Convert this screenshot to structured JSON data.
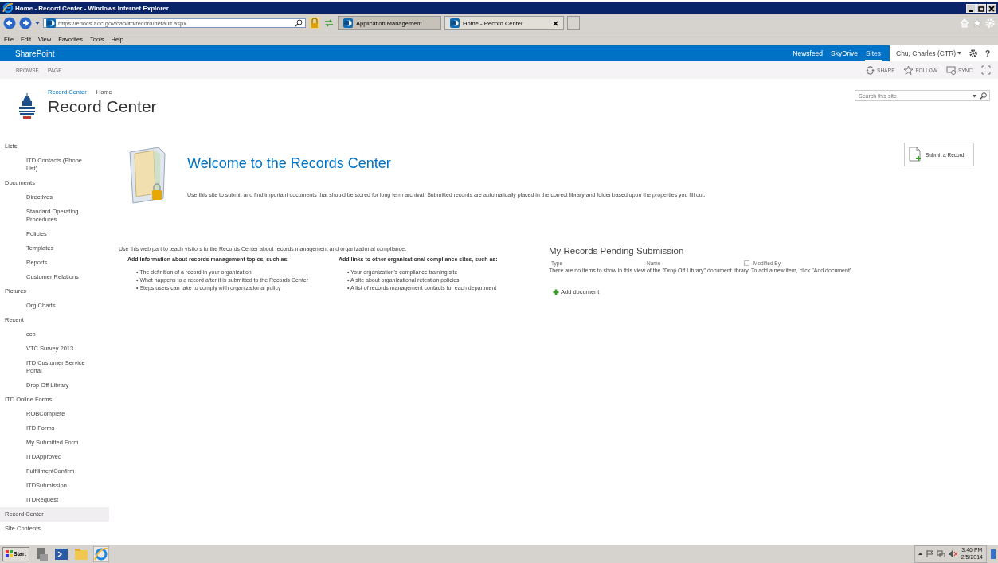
{
  "window": {
    "title": "Home - Record Center - Windows Internet Explorer"
  },
  "browser": {
    "url": "https://edocs.aoc.gov/cao/itd/record/default.aspx",
    "tabs": [
      {
        "label": "Application Management",
        "selected": false
      },
      {
        "label": "Home - Record Center",
        "selected": true
      }
    ]
  },
  "menu_bar": [
    "File",
    "Edit",
    "View",
    "Favorites",
    "Tools",
    "Help"
  ],
  "suite_bar": {
    "brand": "SharePoint",
    "links": [
      {
        "label": "Newsfeed",
        "selected": false
      },
      {
        "label": "SkyDrive",
        "selected": false
      },
      {
        "label": "Sites",
        "selected": true
      }
    ],
    "user": "Chu, Charles (CTR)",
    "help": "?"
  },
  "ribbon": {
    "tabs": [
      "BROWSE",
      "PAGE"
    ],
    "actions": [
      "SHARE",
      "FOLLOW",
      "SYNC"
    ]
  },
  "header": {
    "breadcrumb": [
      "Record Center",
      "Home"
    ],
    "site_title": "Record Center",
    "search": {
      "placeholder": "Search this site"
    }
  },
  "quick_launch": [
    {
      "label": "Lists",
      "selected": false,
      "children": [
        {
          "label": "ITD Contacts (Phone List)",
          "selected": false
        }
      ]
    },
    {
      "label": "Documents",
      "selected": false,
      "children": [
        {
          "label": "Directives",
          "selected": false
        },
        {
          "label": "Standard Operating Procedures",
          "selected": false
        },
        {
          "label": "Policies",
          "selected": false
        },
        {
          "label": "Templates",
          "selected": false
        },
        {
          "label": "Reports",
          "selected": false
        },
        {
          "label": "Customer Relations",
          "selected": false
        }
      ]
    },
    {
      "label": "Pictures",
      "selected": false,
      "children": [
        {
          "label": "Org Charts",
          "selected": false
        }
      ]
    },
    {
      "label": "Recent",
      "selected": false,
      "children": [
        {
          "label": "ccb",
          "selected": false
        },
        {
          "label": "VTC Survey 2013",
          "selected": false
        },
        {
          "label": "ITD Customer Service Portal",
          "selected": false
        },
        {
          "label": "Drop Off Library",
          "selected": false
        }
      ]
    },
    {
      "label": "ITD Online Forms",
      "selected": false,
      "children": [
        {
          "label": "ROBComplete",
          "selected": false
        },
        {
          "label": "ITD Forms",
          "selected": false
        },
        {
          "label": "My Submitted Form",
          "selected": false
        },
        {
          "label": "ITDApproved",
          "selected": false
        },
        {
          "label": "FulfillmentConfirm",
          "selected": false
        },
        {
          "label": "ITDSubmission",
          "selected": false
        },
        {
          "label": "ITDRequest",
          "selected": false
        }
      ]
    },
    {
      "label": "Record Center",
      "selected": true
    },
    {
      "label": "Site Contents",
      "selected": false
    }
  ],
  "welcome": {
    "title": "Welcome to the Records Center",
    "text": "Use this site to submit and find important documents that should be stored for long term archival. Submitted records are automatically placed in the correct library and folder based upon the properties you fill out.",
    "submit_button": "Submit a Record"
  },
  "info": {
    "intro": "Use this web part to teach visitors to the Records Center about records management and organizational compliance.",
    "columns": [
      {
        "heading": "Add information about records management topics, such as:",
        "items": [
          "• The definition of a record in your organization",
          "• What happens to a record after it is submitted to the Records Center",
          "• Steps users can take to comply with organizational policy"
        ]
      },
      {
        "heading": "Add links to other organizational compliance sites, such as:",
        "items": [
          "• Your organization's compliance training site",
          "• A site about organizational retention policies",
          "• A list of records management contacts for each department"
        ]
      }
    ]
  },
  "pending": {
    "title": "My Records Pending Submission",
    "columns": [
      "Type",
      "Name",
      "Modified By"
    ],
    "select_all_checked": false,
    "empty_text": "There are no items to show in this view of the \"Drop Off Library\" document library. To add a new item, click \"Add document\".",
    "add_link": "Add document"
  },
  "taskbar": {
    "start": "Start",
    "time": "3:46 PM",
    "date": "2/5/2014"
  }
}
